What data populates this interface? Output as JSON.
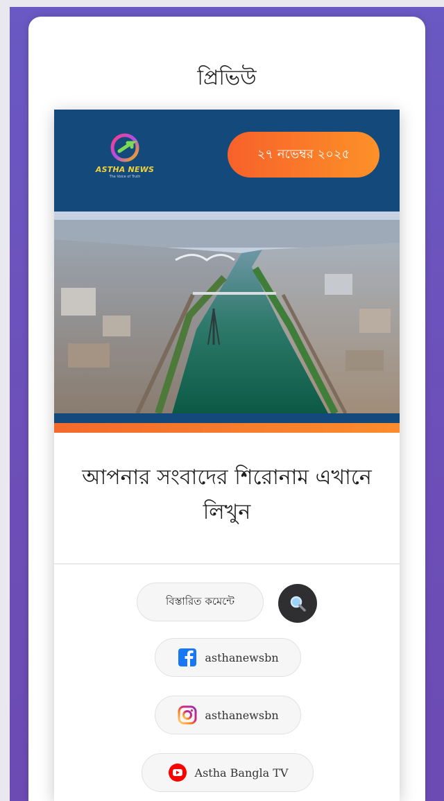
{
  "preview_title": "প্রিভিউ",
  "brand": {
    "name": "ASTHA NEWS",
    "tagline": "The Voice of Truth"
  },
  "date_badge": "২৭ নভেম্বর ২০২৫",
  "headline": "আপনার সংবাদের শিরোনাম এখানে লিখুন",
  "comment_button": "বিস্তারিত কমেন্টে",
  "social": {
    "facebook": "asthanewsbn",
    "instagram": "asthanewsbn",
    "youtube": "Astha Bangla TV"
  },
  "colors": {
    "header_blue": "#144a7b",
    "accent_orange": "#f7612a",
    "panel_purple": "#6a59c2"
  },
  "icons": [
    "search-icon",
    "facebook-icon",
    "instagram-icon",
    "youtube-icon"
  ]
}
